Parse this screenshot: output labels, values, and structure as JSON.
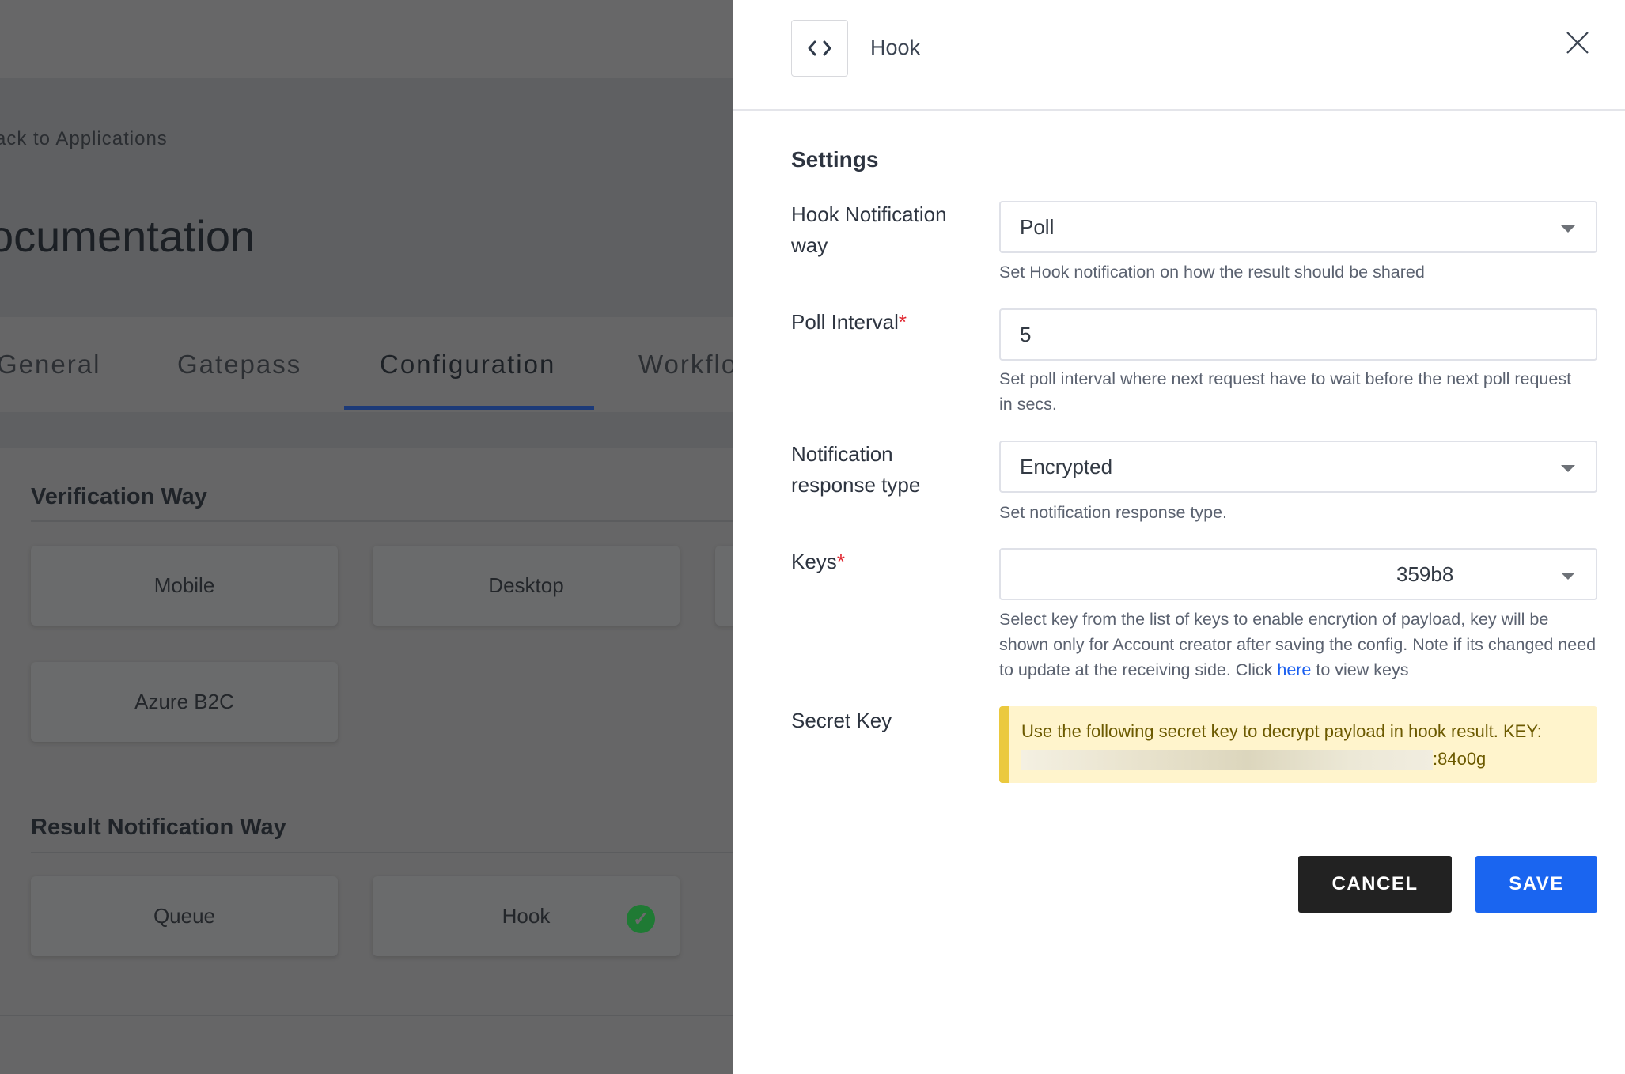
{
  "background": {
    "back_link": "ack to Applications",
    "page_title": "ocumentation",
    "tabs": [
      {
        "label": "General"
      },
      {
        "label": "Gatepass"
      },
      {
        "label": "Configuration",
        "active": true
      },
      {
        "label": "Workflo"
      }
    ],
    "verification_way": {
      "title": "Verification Way",
      "options": [
        {
          "label": "Mobile"
        },
        {
          "label": "Desktop"
        },
        {
          "label": "Azure B2C"
        }
      ]
    },
    "result_notification_way": {
      "title": "Result Notification Way",
      "options": [
        {
          "label": "Queue"
        },
        {
          "label": "Hook",
          "selected": true
        }
      ]
    }
  },
  "drawer": {
    "icon": "code-brackets-icon",
    "title": "Hook",
    "section_title": "Settings",
    "fields": {
      "notification_way": {
        "label": "Hook Notification way",
        "value": "Poll",
        "help": "Set Hook notification on how the result should be shared"
      },
      "poll_interval": {
        "label": "Poll Interval",
        "required_mark": "*",
        "value": "5",
        "help": "Set poll interval where next request have to wait before the next poll request in secs."
      },
      "response_type": {
        "label": "Notification response type",
        "value": "Encrypted",
        "help": "Set notification response type."
      },
      "keys": {
        "label": "Keys",
        "required_mark": "*",
        "value": "359b8",
        "help_before": "Select key from the list of keys to enable encrytion of payload, key will be shown only for Account creator after saving the config. Note if its changed need to update at the receiving side. Click ",
        "help_link": "here",
        "help_after": " to view keys"
      },
      "secret_key": {
        "label": "Secret Key",
        "message": "Use the following secret key to decrypt payload in hook result. KEY:",
        "key_suffix": ":84o0g"
      }
    },
    "buttons": {
      "cancel": "CANCEL",
      "save": "SAVE"
    },
    "colors": {
      "primary": "#1a65f0",
      "cancel": "#222222",
      "warning_bg": "#fff4cc",
      "warning_border": "#ebc93e",
      "success": "#1f7a34"
    }
  }
}
